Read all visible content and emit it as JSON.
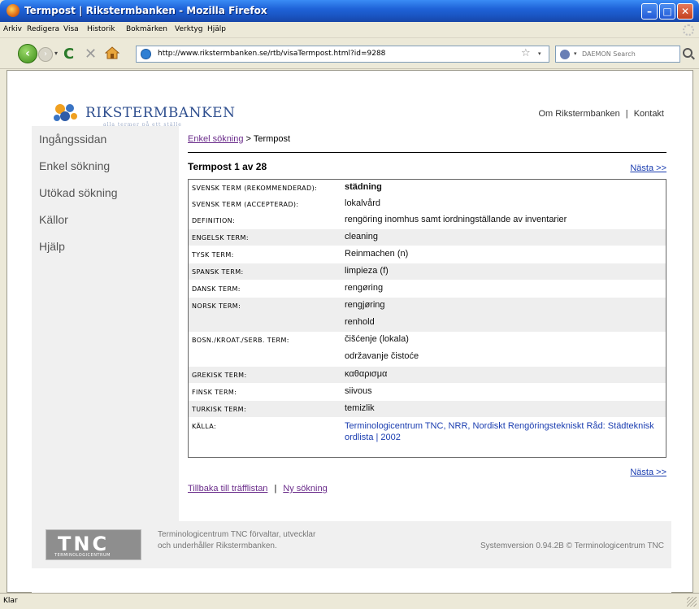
{
  "window": {
    "title": "Termpost | Rikstermbanken - Mozilla Firefox",
    "min_label": "–",
    "max_label": "□",
    "close_label": "✕"
  },
  "menubar": {
    "items": [
      "Arkiv",
      "Redigera",
      "Visa",
      "Historik",
      "Bokmärken",
      "Verktyg",
      "Hjälp"
    ]
  },
  "toolbar": {
    "back_glyph": "‹",
    "forward_glyph": "›",
    "dropdown_glyph": "▾",
    "reload_glyph": "C",
    "stop_glyph": "✕",
    "url": "http://www.rikstermbanken.se/rtb/visaTermpost.html?id=9288",
    "star_glyph": "☆",
    "search_placeholder": "DAEMON Search"
  },
  "header": {
    "logo_text": "RIKSTERMBANKEN",
    "logo_tagline": "alla termer på ett ställe",
    "links": [
      "Om Rikstermbanken",
      "Kontakt"
    ],
    "links_separator": "|"
  },
  "leftnav": {
    "items": [
      "Ingångssidan",
      "Enkel sökning",
      "Utökad sökning",
      "Källor",
      "Hjälp"
    ]
  },
  "main": {
    "breadcrumb_link": "Enkel sökning",
    "breadcrumb_sep": " > ",
    "breadcrumb_current": "Termpost",
    "post_title": "Termpost 1 av 28",
    "next_label": "Nästa >>",
    "rows": [
      {
        "label": "SVENSK TERM (REKOMMENDERAD):",
        "value": "städning"
      },
      {
        "label": "SVENSK TERM (ACCEPTERAD):",
        "value": "lokalvård"
      },
      {
        "label": "DEFINITION:",
        "value": "rengöring inomhus samt iordningställande av inventarier"
      },
      {
        "label": "ENGELSK TERM:",
        "value": "cleaning"
      },
      {
        "label": "TYSK TERM:",
        "value": "Reinmachen (n)"
      },
      {
        "label": "SPANSK TERM:",
        "value": "limpieza (f)"
      },
      {
        "label": "DANSK TERM:",
        "value": "rengøring"
      },
      {
        "label": "NORSK TERM:",
        "value": "rengjøring"
      },
      {
        "label": "",
        "value": "renhold"
      },
      {
        "label": "BOSN./KROAT./SERB. TERM:",
        "value": "čišćenje (lokala)"
      },
      {
        "label": "",
        "value": "održavanje čistoće"
      },
      {
        "label": "GREKISK TERM:",
        "value": "καθαρισμα"
      },
      {
        "label": "FINSK TERM:",
        "value": "siivous"
      },
      {
        "label": "TURKISK TERM:",
        "value": "temizlik"
      },
      {
        "label": "KÄLLA:",
        "value": "Terminologicentrum TNC, NRR, Nordiskt Rengöringstekniskt Råd: Städteknisk ordlista | 2002"
      }
    ],
    "back_link": "Tillbaka till träfflistan",
    "link_separator": "|",
    "new_search_link": "Ny sökning"
  },
  "footer": {
    "tnc_letters": "TNC",
    "tnc_sub": "TERMINOLOGICENTRUM",
    "text_line1": "Terminologicentrum TNC förvaltar, utvecklar",
    "text_line2": "och underhåller Rikstermbanken.",
    "version": "Systemversion 0.94.2B © Terminologicentrum TNC"
  },
  "statusbar": {
    "text": "Klar"
  }
}
